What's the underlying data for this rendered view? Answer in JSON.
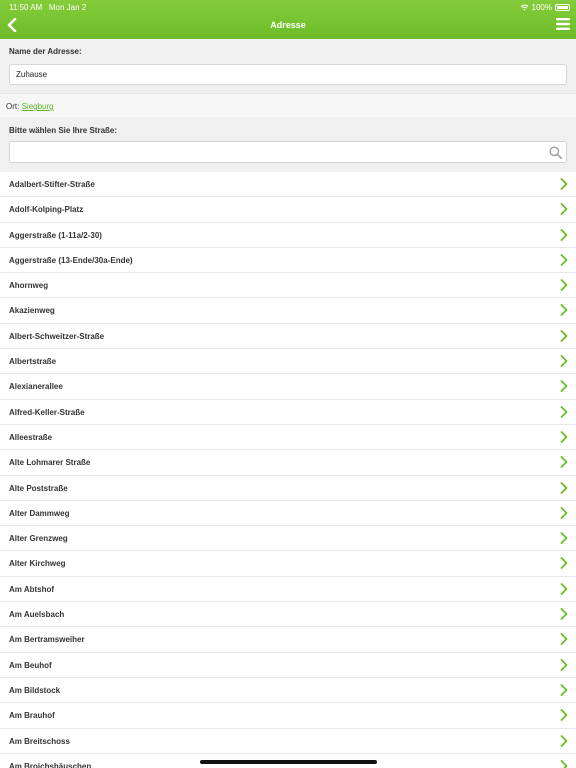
{
  "status_bar": {
    "time": "11:50 AM",
    "date": "Mon Jan 2",
    "battery": "100%"
  },
  "header": {
    "title": "Adresse"
  },
  "colors": {
    "accent": "#6cbb28",
    "link": "#5cb521"
  },
  "name_section": {
    "label": "Name der Adresse:",
    "value": "Zuhause"
  },
  "location": {
    "prefix": "Ort:",
    "city": "Siegburg"
  },
  "street_section": {
    "label": "Bitte wählen Sie Ihre Straße:",
    "search_value": ""
  },
  "streets": [
    "Adalbert-Stifter-Straße",
    "Adolf-Kolping-Platz",
    "Aggerstraße (1-11a/2-30)",
    "Aggerstraße (13-Ende/30a-Ende)",
    "Ahornweg",
    "Akazienweg",
    "Albert-Schweitzer-Straße",
    "Albertstraße",
    "Alexianerallee",
    "Alfred-Keller-Straße",
    "Alleestraße",
    "Alte Lohmarer Straße",
    "Alte Poststraße",
    "Alter Dammweg",
    "Alter Grenzweg",
    "Alter Kirchweg",
    "Am Abtshof",
    "Am Auelsbach",
    "Am Bertramsweiher",
    "Am Beuhof",
    "Am Bildstock",
    "Am Brauhof",
    "Am Breitschoss",
    "Am Broichshäuschen"
  ],
  "icons": {
    "back": "chevron-left-icon",
    "menu": "hamburger-menu-icon",
    "search": "magnifier-icon",
    "row": "chevron-right-icon"
  }
}
